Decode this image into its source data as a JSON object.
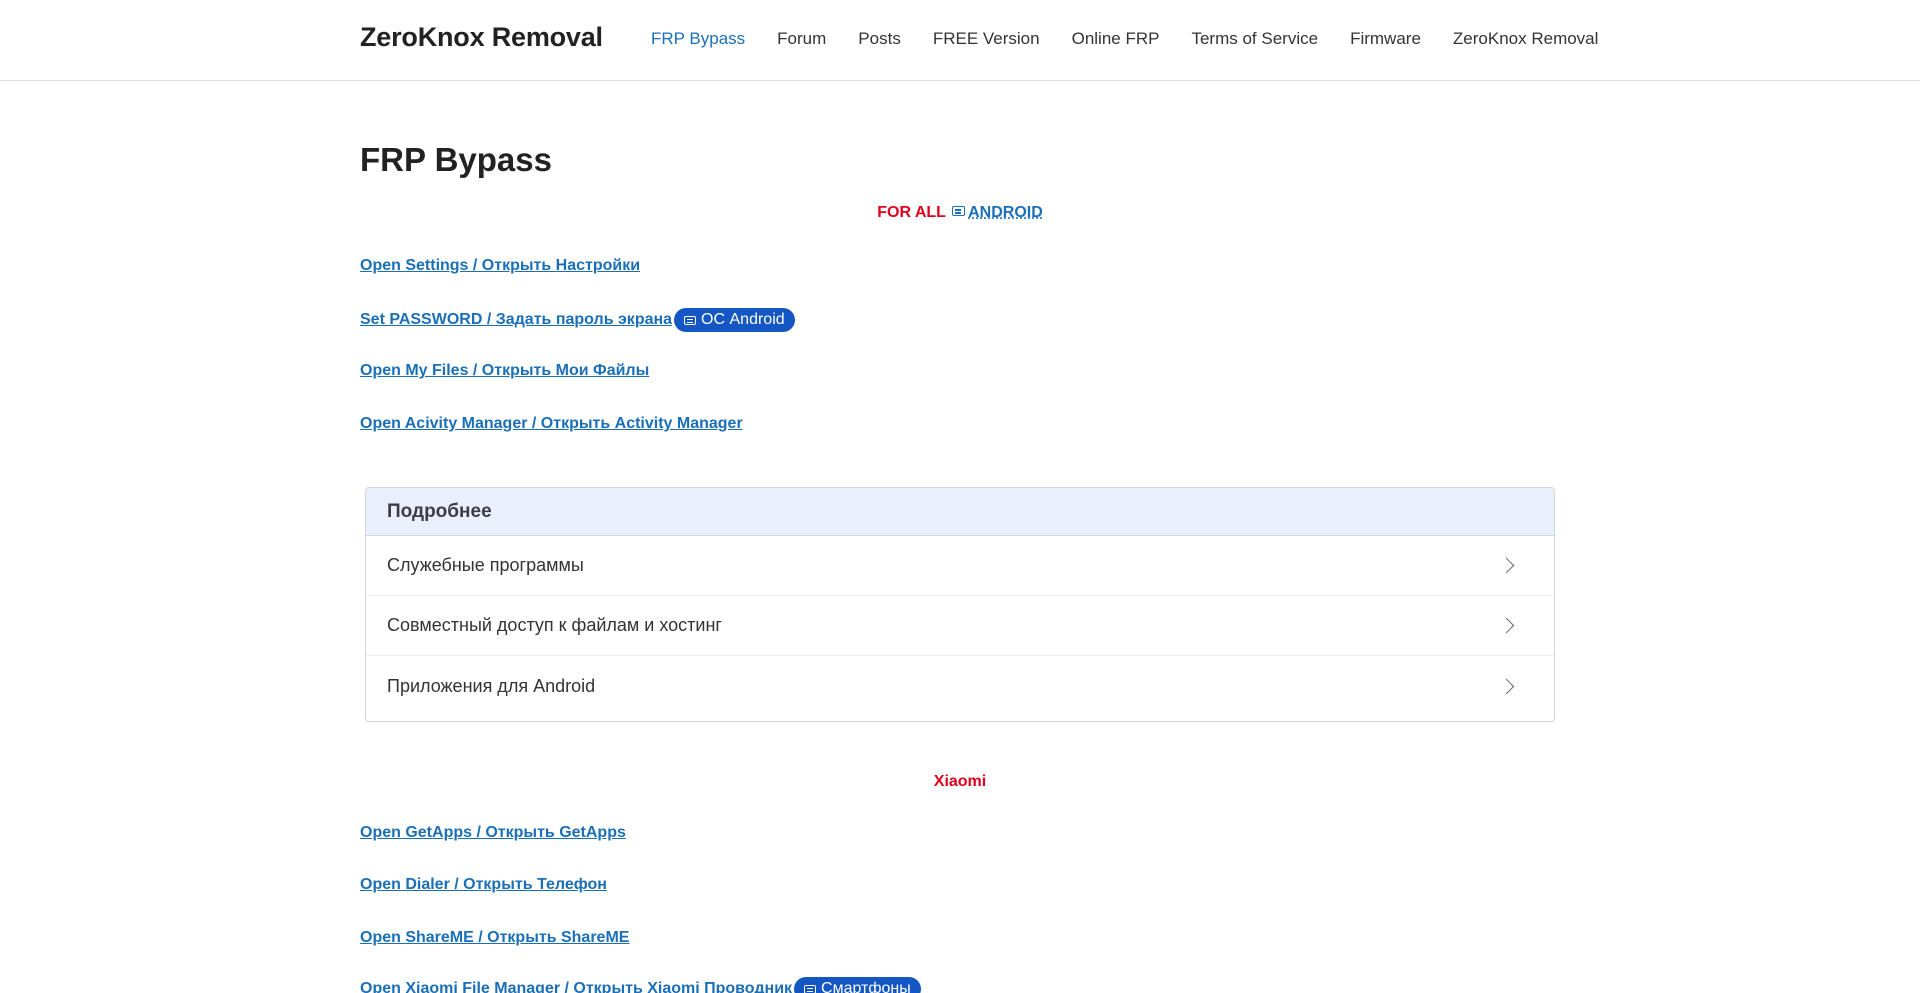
{
  "header": {
    "brand": "ZeroKnox Removal",
    "nav": [
      {
        "label": "FRP Bypass",
        "active": true
      },
      {
        "label": "Forum"
      },
      {
        "label": "Posts"
      },
      {
        "label": "FREE Version"
      },
      {
        "label": "Online FRP"
      },
      {
        "label": "Terms of Service"
      },
      {
        "label": "Firmware"
      },
      {
        "label": "ZeroKnox Removal"
      }
    ]
  },
  "page": {
    "title": "FRP Bypass",
    "section_all": {
      "prefix": "FOR ALL",
      "link": "ANDROID"
    },
    "links_all": [
      {
        "label": "Open Settings / Открыть Настройки"
      },
      {
        "label": "Set PASSWORD / Задать пароль экрана",
        "badge": "ОС Android"
      },
      {
        "label": "Open My Files / Открыть Мои Файлы"
      },
      {
        "label": "Open Acivity Manager / Открыть Activity Manager"
      }
    ],
    "details": {
      "header": "Подробнее",
      "items": [
        "Служебные программы",
        "Совместный доступ к файлам и хостинг",
        "Приложения для Android"
      ]
    },
    "section_xiaomi": "Xiaomi",
    "links_xiaomi": [
      {
        "label": "Open GetApps / Открыть GetApps"
      },
      {
        "label": "Open Dialer / Открыть Телефон"
      },
      {
        "label": "Open ShareME / Открыть ShareME"
      },
      {
        "label": "Open Xiaomi File Manager / Открыть Xiaomi Проводник",
        "badge": "Смартфоны"
      }
    ],
    "colors": {
      "accent": "#1a6fb8",
      "red": "#e0001b",
      "badge": "#1456c4"
    }
  }
}
